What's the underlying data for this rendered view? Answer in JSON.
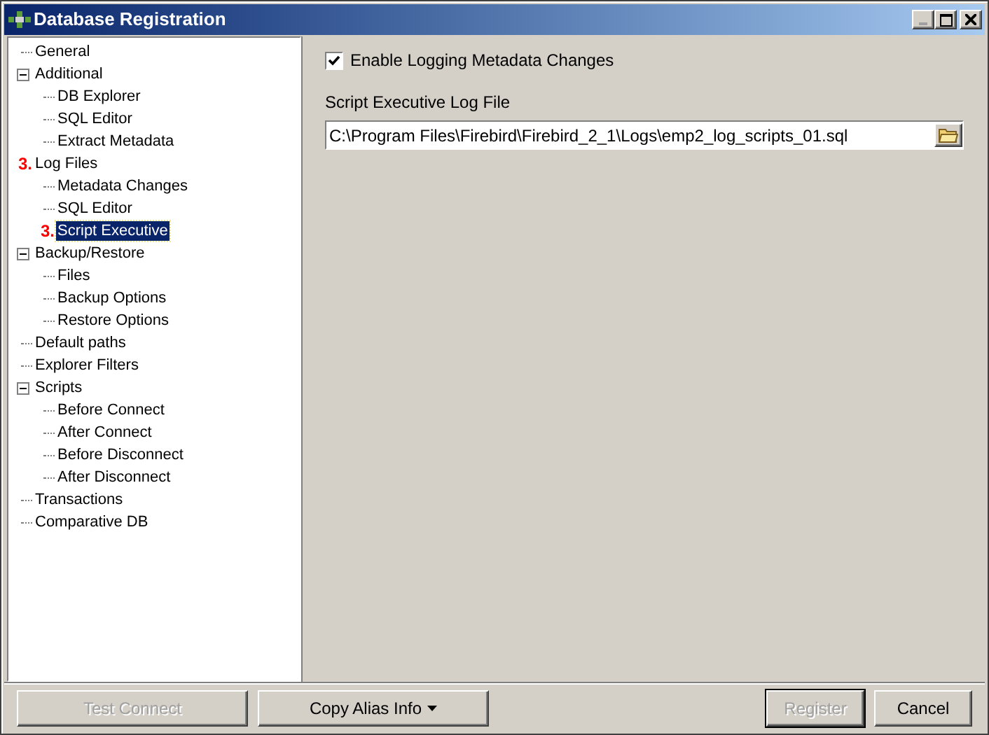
{
  "window": {
    "title": "Database Registration",
    "buttons": [
      {
        "kind": "minimize",
        "disabled": true
      },
      {
        "kind": "maximize",
        "disabled": false
      },
      {
        "kind": "close",
        "disabled": false
      }
    ]
  },
  "tree": [
    {
      "label": "General",
      "selected": false
    },
    {
      "label": "Additional",
      "selected": false,
      "expanded": true,
      "children": [
        {
          "label": "DB Explorer",
          "selected": false
        },
        {
          "label": "SQL Editor",
          "selected": false
        },
        {
          "label": "Extract Metadata",
          "selected": false
        }
      ]
    },
    {
      "label": "Log Files",
      "selected": false,
      "marker": "3.",
      "children": [
        {
          "label": "Metadata Changes",
          "selected": false
        },
        {
          "label": "SQL Editor",
          "selected": false
        },
        {
          "label": "Script Executive",
          "selected": true,
          "marker": "3."
        }
      ]
    },
    {
      "label": "Backup/Restore",
      "selected": false,
      "expanded": true,
      "children": [
        {
          "label": "Files",
          "selected": false
        },
        {
          "label": "Backup Options",
          "selected": false
        },
        {
          "label": "Restore Options",
          "selected": false
        }
      ]
    },
    {
      "label": "Default paths",
      "selected": false
    },
    {
      "label": "Explorer Filters",
      "selected": false
    },
    {
      "label": "Scripts",
      "selected": false,
      "expanded": true,
      "children": [
        {
          "label": "Before Connect",
          "selected": false
        },
        {
          "label": "After Connect",
          "selected": false
        },
        {
          "label": "Before Disconnect",
          "selected": false
        },
        {
          "label": "After Disconnect",
          "selected": false
        }
      ]
    },
    {
      "label": "Transactions",
      "selected": false
    },
    {
      "label": "Comparative DB",
      "selected": false
    }
  ],
  "content": {
    "checkbox": {
      "label": "Enable Logging Metadata Changes",
      "checked": true
    },
    "file_label": "Script Executive Log File",
    "file_value": "C:\\Program Files\\Firebird\\Firebird_2_1\\Logs\\emp2_log_scripts_01.sql"
  },
  "left_buttons": [
    {
      "label": "Test Connect",
      "disabled": true,
      "dropdown": false,
      "default": false
    },
    {
      "label": "Copy Alias Info",
      "disabled": false,
      "dropdown": true,
      "default": false
    }
  ],
  "right_buttons": [
    {
      "label": "Register",
      "disabled": true,
      "dropdown": false,
      "default": true
    },
    {
      "label": "Cancel",
      "disabled": false,
      "dropdown": false,
      "default": false
    }
  ]
}
